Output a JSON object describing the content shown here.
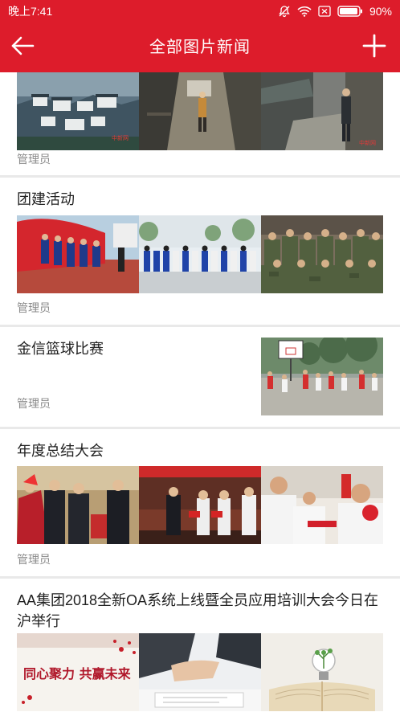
{
  "status_bar": {
    "time": "晚上7:41",
    "battery": "90%"
  },
  "header": {
    "title": "全部图片新闻"
  },
  "articles": [
    {
      "title": "",
      "author": "管理员",
      "watermark": "中新网"
    },
    {
      "title": "团建活动",
      "author": "管理员"
    },
    {
      "title": "金信篮球比赛",
      "author": "管理员"
    },
    {
      "title": "年度总结大会",
      "author": "管理员"
    },
    {
      "title": "AA集团2018全新OA系统上线暨全员应用培训大会今日在沪举行",
      "author": "",
      "banner_text": "同心聚力 共赢未来"
    }
  ],
  "colors": {
    "brand": "#dd1c2b",
    "divider": "#e9e9e9",
    "meta": "#8a8a8a"
  },
  "icons": [
    "mute-icon",
    "wifi-icon",
    "sim-icon",
    "battery-icon",
    "back-arrow-icon",
    "plus-icon"
  ]
}
